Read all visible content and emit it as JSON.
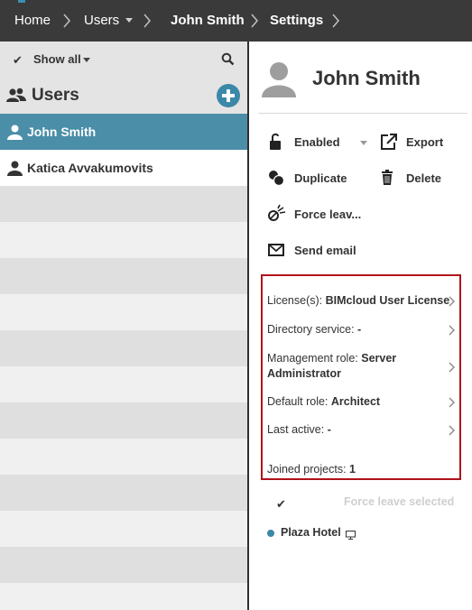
{
  "breadcrumb": {
    "items": [
      "Home",
      "Users",
      "John Smith",
      "Settings"
    ]
  },
  "left": {
    "filter_label": "Show all",
    "section_title": "Users",
    "users": [
      {
        "name": "John Smith",
        "selected": true
      },
      {
        "name": "Katica Avvakumovits",
        "selected": false
      }
    ]
  },
  "right": {
    "user_name": "John Smith",
    "actions": {
      "enabled": "Enabled",
      "export": "Export",
      "duplicate": "Duplicate",
      "delete": "Delete",
      "force_leave": "Force leav...",
      "send_email": "Send email"
    },
    "details": {
      "license_label": "License(s):",
      "license_value": "BIMcloud User License",
      "directory_label": "Directory service:",
      "directory_value": "-",
      "mgmt_label": "Management role:",
      "mgmt_value_1": "Server",
      "mgmt_value_2": "Administrator",
      "default_label": "Default role:",
      "default_value": "Architect",
      "last_label": "Last active:",
      "last_value": "-",
      "joined_label": "Joined projects:",
      "joined_value": "1"
    },
    "force_leave_selected": "Force leave selected",
    "projects": [
      {
        "name": "Plaza Hotel"
      }
    ]
  },
  "colors": {
    "accent": "#3b88a8",
    "topbar": "#3a3a3a",
    "highlight_border": "#b0121b",
    "selected_row": "#4a8ea8"
  },
  "icons": [
    "chevron-right-icon",
    "caret-down-icon",
    "checkmark-icon",
    "search-icon",
    "users-icon",
    "add-icon",
    "person-icon",
    "avatar-icon",
    "unlock-icon",
    "export-icon",
    "duplicate-icon",
    "trash-icon",
    "force-leave-icon",
    "email-icon",
    "monitor-icon"
  ]
}
